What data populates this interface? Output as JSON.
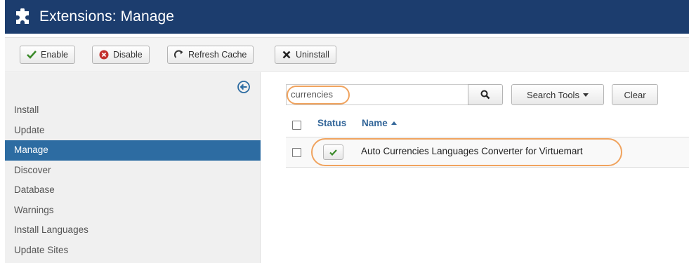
{
  "header": {
    "title": "Extensions: Manage",
    "icon": "puzzle-icon",
    "bg_color": "#1c3d6e"
  },
  "toolbar": {
    "enable_label": "Enable",
    "disable_label": "Disable",
    "refresh_label": "Refresh Cache",
    "uninstall_label": "Uninstall"
  },
  "sidebar": {
    "items": [
      {
        "label": "Install",
        "active": false
      },
      {
        "label": "Update",
        "active": false
      },
      {
        "label": "Manage",
        "active": true
      },
      {
        "label": "Discover",
        "active": false
      },
      {
        "label": "Database",
        "active": false
      },
      {
        "label": "Warnings",
        "active": false
      },
      {
        "label": "Install Languages",
        "active": false
      },
      {
        "label": "Update Sites",
        "active": false
      }
    ],
    "active_color": "#2d6ca2"
  },
  "search": {
    "value": "currencies",
    "tools_label": "Search Tools",
    "clear_label": "Clear"
  },
  "table": {
    "columns": {
      "status": "Status",
      "name": "Name"
    },
    "rows": [
      {
        "status": "enabled",
        "name": "Auto Currencies Languages Converter for Virtuemart"
      }
    ]
  },
  "highlight_color": "#f0a35e"
}
